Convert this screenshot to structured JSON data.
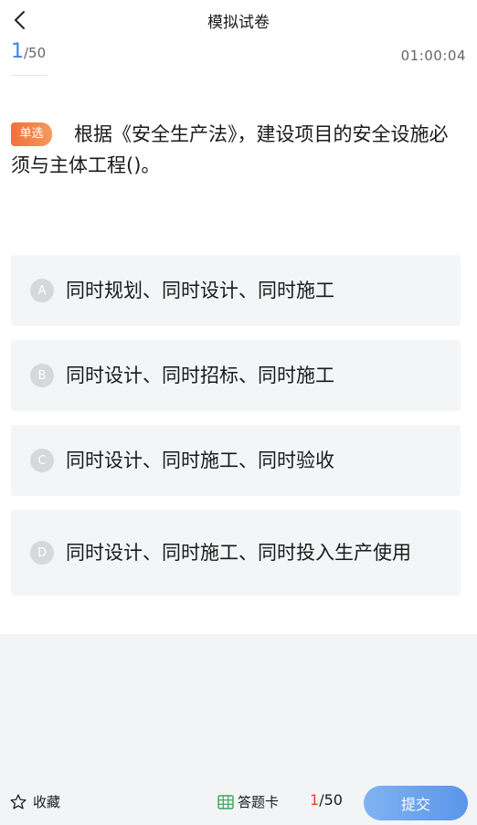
{
  "header": {
    "title": "模拟试卷",
    "back_icon": "chevron-left-icon"
  },
  "progress": {
    "current": "1",
    "total": "/50"
  },
  "timer": "01:00:04",
  "question": {
    "type_badge": "单选",
    "text": "根据《安全生产法》，建设项目的安全设施必须与主体工程()。",
    "badge_colors": [
      "#f0703a",
      "#f59a5f"
    ]
  },
  "options": [
    {
      "letter": "A",
      "text": "同时规划、同时设计、同时施工"
    },
    {
      "letter": "B",
      "text": "同时设计、同时招标、同时施工"
    },
    {
      "letter": "C",
      "text": "同时设计、同时施工、同时验收"
    },
    {
      "letter": "D",
      "text": "同时设计、同时施工、同时投入生产使用"
    }
  ],
  "bottom": {
    "favorite_label": "收藏",
    "favorite_icon": "star-outline-icon",
    "answer_card_label": "答题卡",
    "answer_card_icon": "grid-icon",
    "progress_current": "1",
    "progress_total": "/50",
    "submit_label": "提交"
  },
  "colors": {
    "accent_blue": "#3c82e6",
    "progress_red": "#e8452c"
  }
}
